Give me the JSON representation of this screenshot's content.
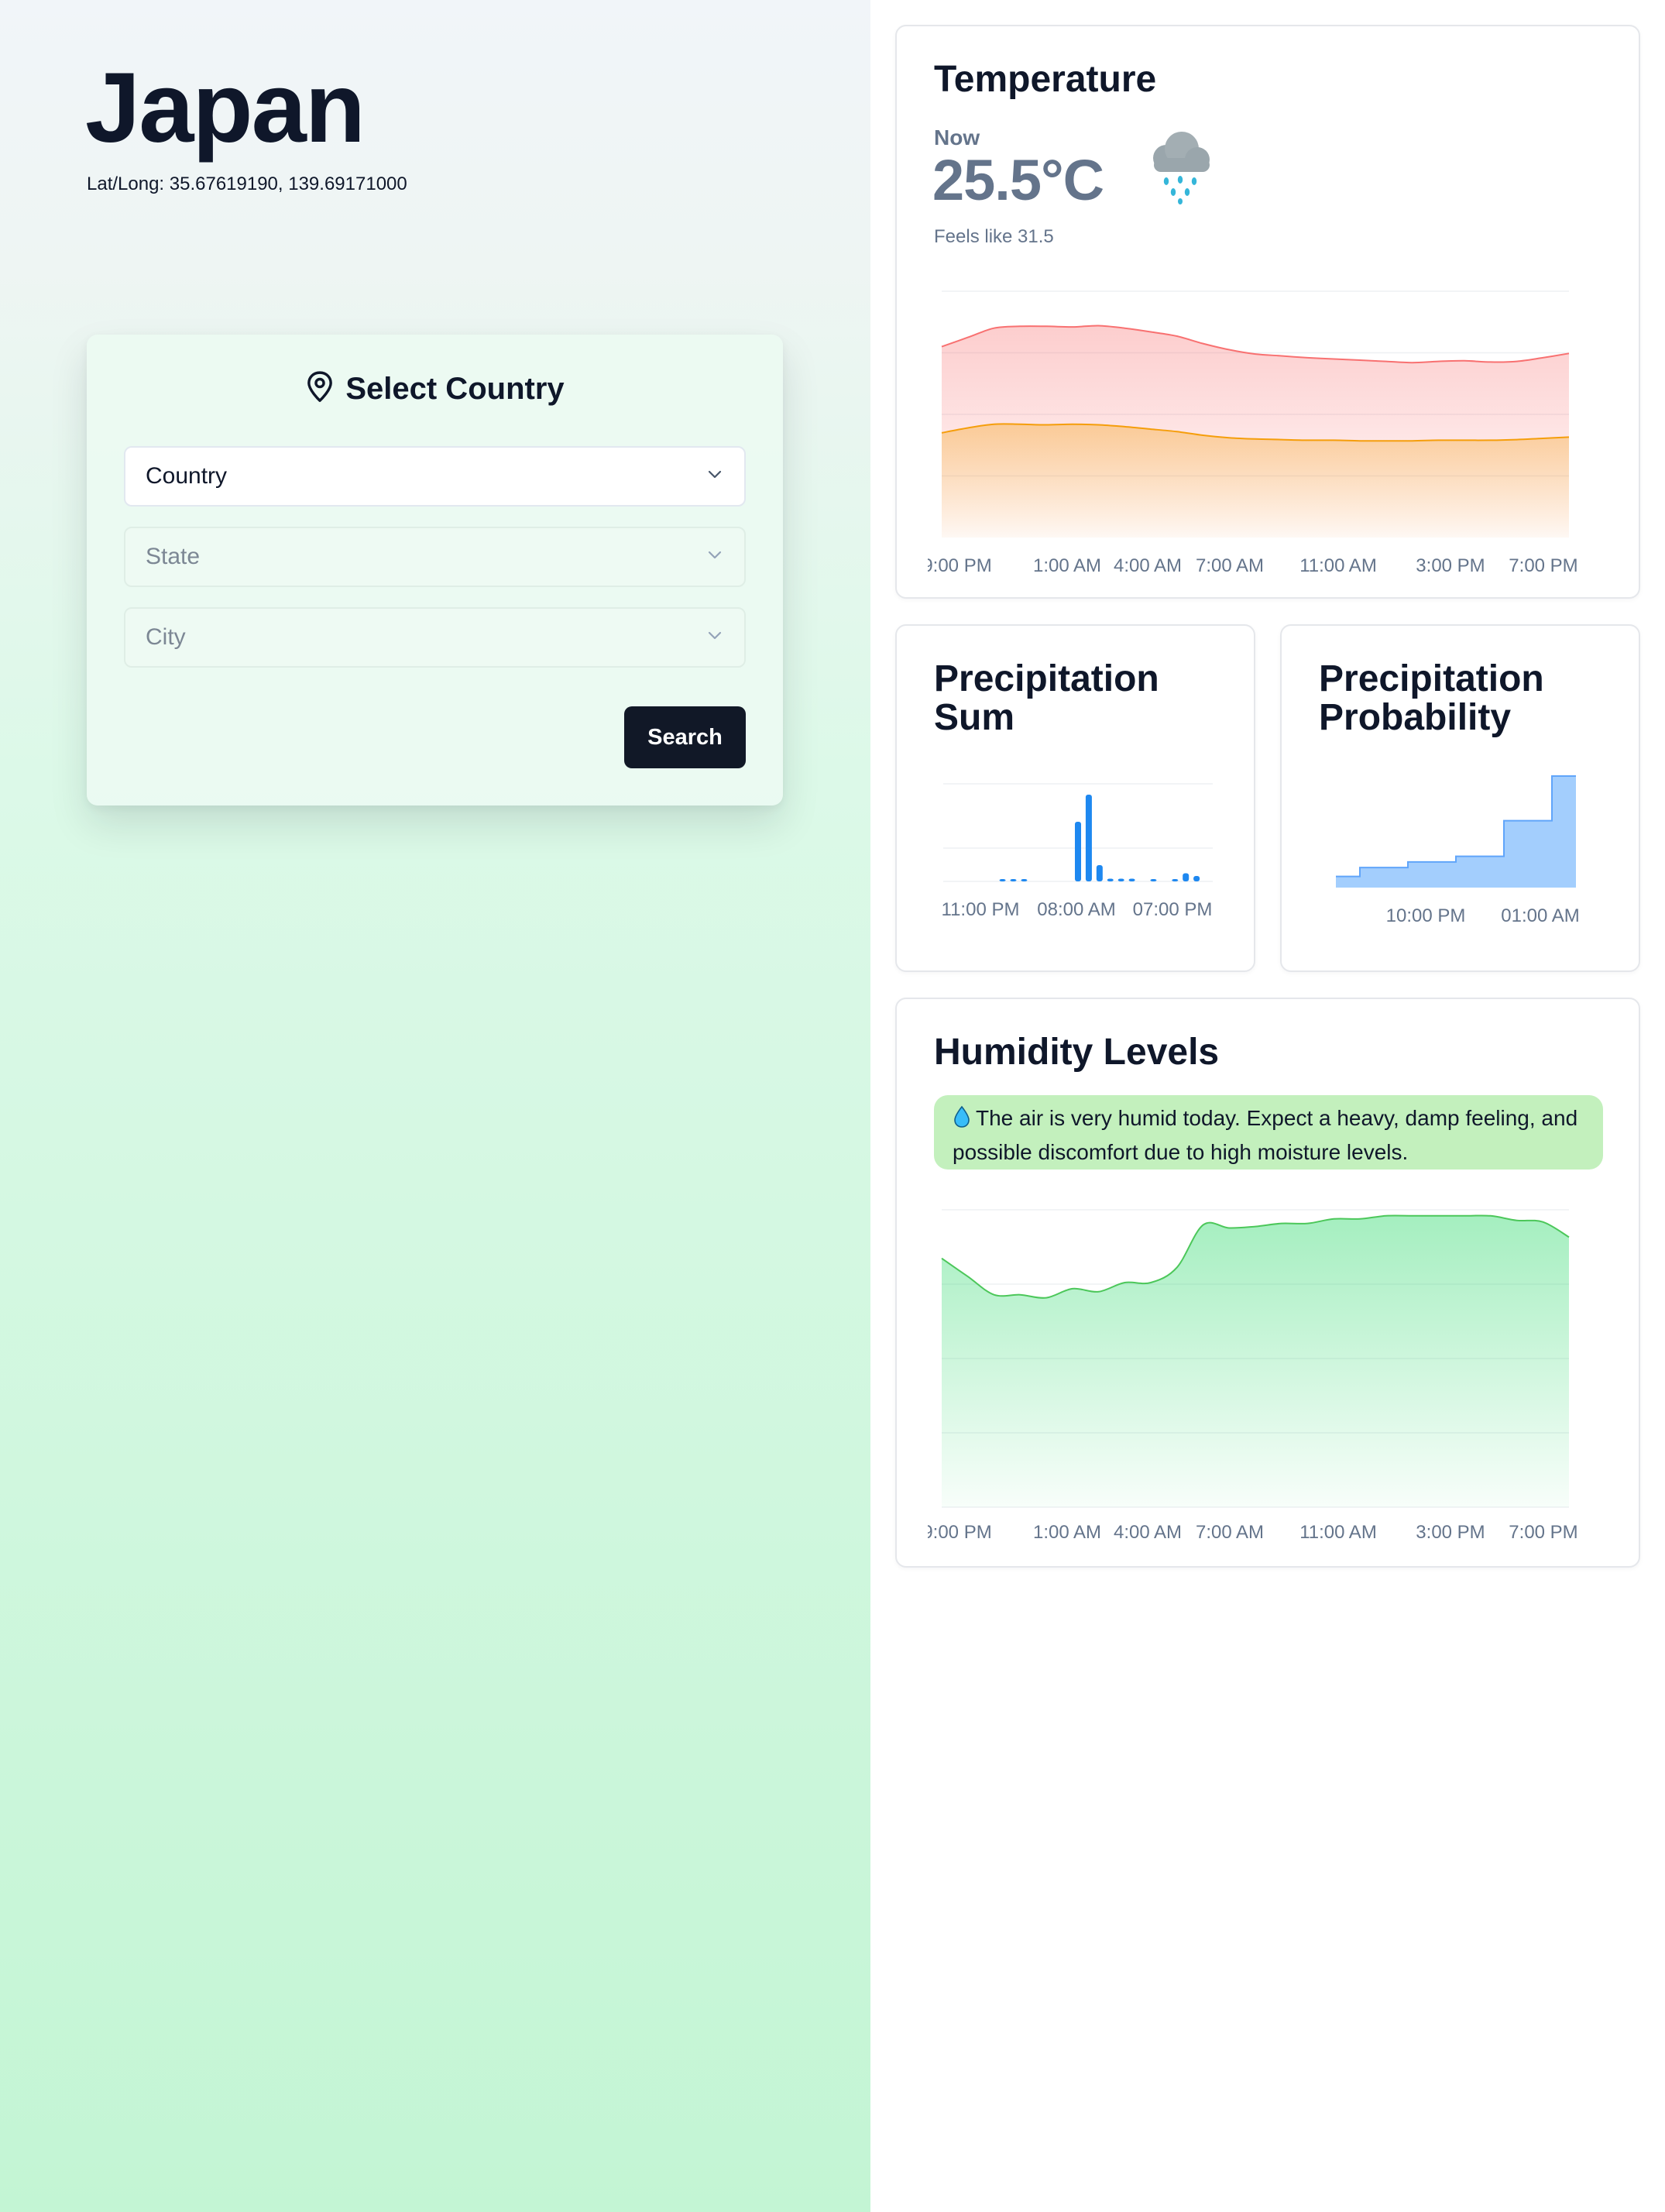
{
  "location": {
    "name": "Japan",
    "latlong": "Lat/Long: 35.67619190, 139.69171000"
  },
  "selector": {
    "title": "Select Country",
    "fields": [
      {
        "value": "Country",
        "disabled": false
      },
      {
        "value": "State",
        "disabled": true
      },
      {
        "value": "City",
        "disabled": true
      }
    ],
    "search_label": "Search"
  },
  "temperature": {
    "title": "Temperature",
    "now_label": "Now",
    "value": "25.5°C",
    "feels_like": "Feels like 31.5",
    "icon": "rain-cloud-icon"
  },
  "precipitation_sum": {
    "title": "Precipitation Sum"
  },
  "precipitation_probability": {
    "title": "Precipitation Probability"
  },
  "humidity": {
    "title": "Humidity Levels",
    "note": "The air is very humid today. Expect a heavy, damp feeling, and possible discomfort due to high moisture levels.",
    "icon": "water-drop-icon"
  },
  "colors": {
    "temp_series": "#f87171",
    "feels_series": "#f59e0b",
    "precip": "#1e88f0",
    "probability": "#93c5fd",
    "humidity": "#4ade80",
    "button": "#111827"
  },
  "chart_data": [
    {
      "id": "temperature",
      "type": "area",
      "x_ticks": [
        "9:00 PM",
        "1:00 AM",
        "4:00 AM",
        "7:00 AM",
        "11:00 AM",
        "3:00 PM",
        "7:00 PM"
      ],
      "ylim": [
        0,
        40
      ],
      "grid": true,
      "series": [
        {
          "key": "temp",
          "values": [
            31,
            32.5,
            34,
            34.3,
            34.3,
            34.2,
            34.4,
            34,
            33.4,
            32.7,
            31.5,
            30.5,
            29.8,
            29.5,
            29.2,
            29,
            28.8,
            28.6,
            28.4,
            28.6,
            28.7,
            28.5,
            28.6,
            29.2,
            29.9
          ]
        },
        {
          "key": "feels",
          "values": [
            17,
            17.8,
            18.4,
            18.4,
            18.3,
            18.4,
            18.3,
            18,
            17.6,
            17.2,
            16.6,
            16.2,
            16,
            15.9,
            15.8,
            15.8,
            15.7,
            15.7,
            15.7,
            15.8,
            15.8,
            15.8,
            15.9,
            16.1,
            16.3
          ]
        }
      ]
    },
    {
      "id": "precipitation_sum",
      "type": "bar",
      "x_ticks": [
        "11:00 PM",
        "08:00 AM",
        "07:00 PM"
      ],
      "ylim": [
        0,
        1.8
      ],
      "values": [
        0,
        0,
        0,
        0,
        0,
        0.02,
        0.02,
        0.02,
        0,
        0,
        0,
        0,
        1.1,
        1.6,
        0.3,
        0.05,
        0.05,
        0.05,
        0,
        0.02,
        0,
        0.02,
        0.15,
        0.1,
        0
      ]
    },
    {
      "id": "precipitation_probability",
      "type": "area",
      "x_ticks": [
        "10:00 PM",
        "01:00 AM"
      ],
      "ylim": [
        0,
        100
      ],
      "values": [
        10,
        18,
        18,
        23,
        23,
        28,
        28,
        60,
        60,
        100,
        100
      ]
    },
    {
      "id": "humidity",
      "type": "area",
      "x_ticks": [
        "9:00 PM",
        "1:00 AM",
        "4:00 AM",
        "7:00 AM",
        "11:00 AM",
        "3:00 PM",
        "7:00 PM"
      ],
      "ylim": [
        0,
        100
      ],
      "grid": true,
      "values": [
        82,
        76,
        70,
        70,
        69,
        72,
        71,
        74,
        74,
        79,
        93,
        92,
        92.5,
        93.5,
        93.5,
        95,
        95,
        96,
        96,
        96,
        96,
        96,
        94.5,
        94,
        89
      ]
    }
  ]
}
